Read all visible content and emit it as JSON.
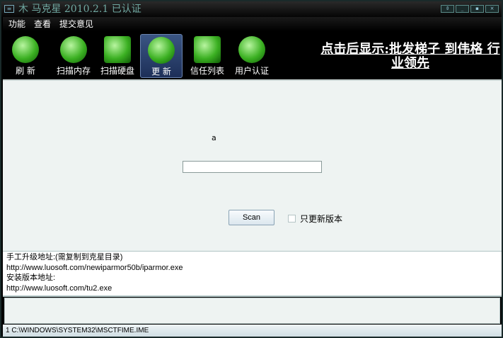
{
  "window": {
    "title": "木 马克星 2010.2.1  已认证",
    "buttons": [
      "restore-toggle",
      "minimize",
      "maximize",
      "close"
    ]
  },
  "menu": [
    "功能",
    "查看",
    "提交意见"
  ],
  "toolbar": [
    {
      "label": "刷 新",
      "icon": "radar-icon"
    },
    {
      "label": "扫描内存",
      "icon": "memory-scan-icon"
    },
    {
      "label": "扫描硬盘",
      "icon": "disk-scan-icon"
    },
    {
      "label": "更 新",
      "icon": "update-icon",
      "active": true
    },
    {
      "label": "信任列表",
      "icon": "trust-list-icon"
    },
    {
      "label": "用户认证",
      "icon": "user-auth-icon"
    }
  ],
  "promo": "点击后显示:批发梯子 到伟格 行业领先",
  "main": {
    "label": "a",
    "input_value": "",
    "scan_label": "Scan",
    "checkbox_label": "只更新版本",
    "checkbox_checked": false
  },
  "log": [
    "手工升级地址:(需复制到克星目录)",
    "http://www.luosoft.com/newiparmor50b/iparmor.exe",
    "安装版本地址:",
    "http://www.luosoft.com/tu2.exe"
  ],
  "status": "1  C:\\WINDOWS\\SYSTEM32\\MSCTFIME.IME"
}
